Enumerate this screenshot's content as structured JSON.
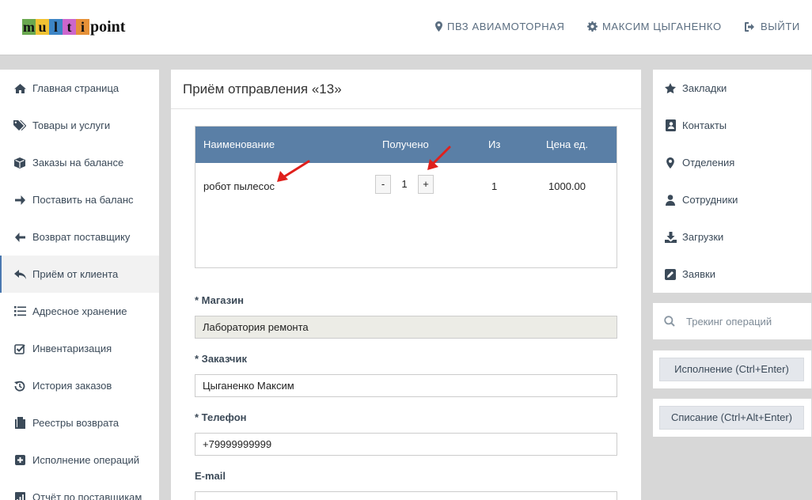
{
  "logo": {
    "letters": [
      {
        "char": "m",
        "bg": "#6aa84f"
      },
      {
        "char": "u",
        "bg": "#f1c232"
      },
      {
        "char": "l",
        "bg": "#3d85c6"
      },
      {
        "char": "t",
        "bg": "#cc66cc"
      },
      {
        "char": "i",
        "bg": "#e69138"
      }
    ],
    "suffix": "point"
  },
  "header": {
    "location": "ПВЗ АВИАМОТОРНАЯ",
    "user": "МАКСИМ ЦЫГАНЕНКО",
    "logout": "ВЫЙТИ"
  },
  "left_nav": [
    {
      "label": "Главная страница",
      "icon": "home-icon"
    },
    {
      "label": "Товары и услуги",
      "icon": "tags-icon"
    },
    {
      "label": "Заказы на балансе",
      "icon": "cube-icon"
    },
    {
      "label": "Поставить на баланс",
      "icon": "arrow-right-icon"
    },
    {
      "label": "Возврат поставщику",
      "icon": "arrow-left-icon"
    },
    {
      "label": "Приём от клиента",
      "icon": "reply-icon",
      "active": true
    },
    {
      "label": "Адресное хранение",
      "icon": "list-icon"
    },
    {
      "label": "Инвентаризация",
      "icon": "checkbox-icon"
    },
    {
      "label": "История заказов",
      "icon": "history-icon"
    },
    {
      "label": "Реестры возврата",
      "icon": "copy-icon"
    },
    {
      "label": "Исполнение операций",
      "icon": "plus-square-icon"
    },
    {
      "label": "Отчёт по поставщикам",
      "icon": "report-icon"
    }
  ],
  "main": {
    "title": "Приём отправления «13»",
    "table": {
      "headers": {
        "name": "Наименование",
        "received": "Получено",
        "of": "Из",
        "price": "Цена ед."
      },
      "rows": [
        {
          "name": "робот пылесос",
          "minus": "-",
          "received": "1",
          "plus": "+",
          "of": "1",
          "price": "1000.00"
        }
      ]
    },
    "fields": {
      "shop_label": "* Магазин",
      "shop_value": "Лаборатория ремонта",
      "customer_label": "* Заказчик",
      "customer_value": "Цыганенко Максим",
      "phone_label": "* Телефон",
      "phone_value": "+79999999999",
      "email_label": "E-mail"
    }
  },
  "right_nav": [
    {
      "label": "Закладки",
      "icon": "star-icon"
    },
    {
      "label": "Контакты",
      "icon": "contact-card-icon"
    },
    {
      "label": "Отделения",
      "icon": "map-marker-icon"
    },
    {
      "label": "Сотрудники",
      "icon": "user-icon"
    },
    {
      "label": "Загрузки",
      "icon": "download-icon"
    },
    {
      "label": "Заявки",
      "icon": "edit-icon"
    }
  ],
  "tracking": {
    "placeholder": "Трекинг операций"
  },
  "actions": {
    "execute": "Исполнение (Ctrl+Enter)",
    "writeoff": "Списание (Ctrl+Alt+Enter)"
  },
  "colors": {
    "table_header": "#5a7fa6",
    "annotation_arrow": "#e0201c",
    "active_marker": "#4a78b0"
  }
}
